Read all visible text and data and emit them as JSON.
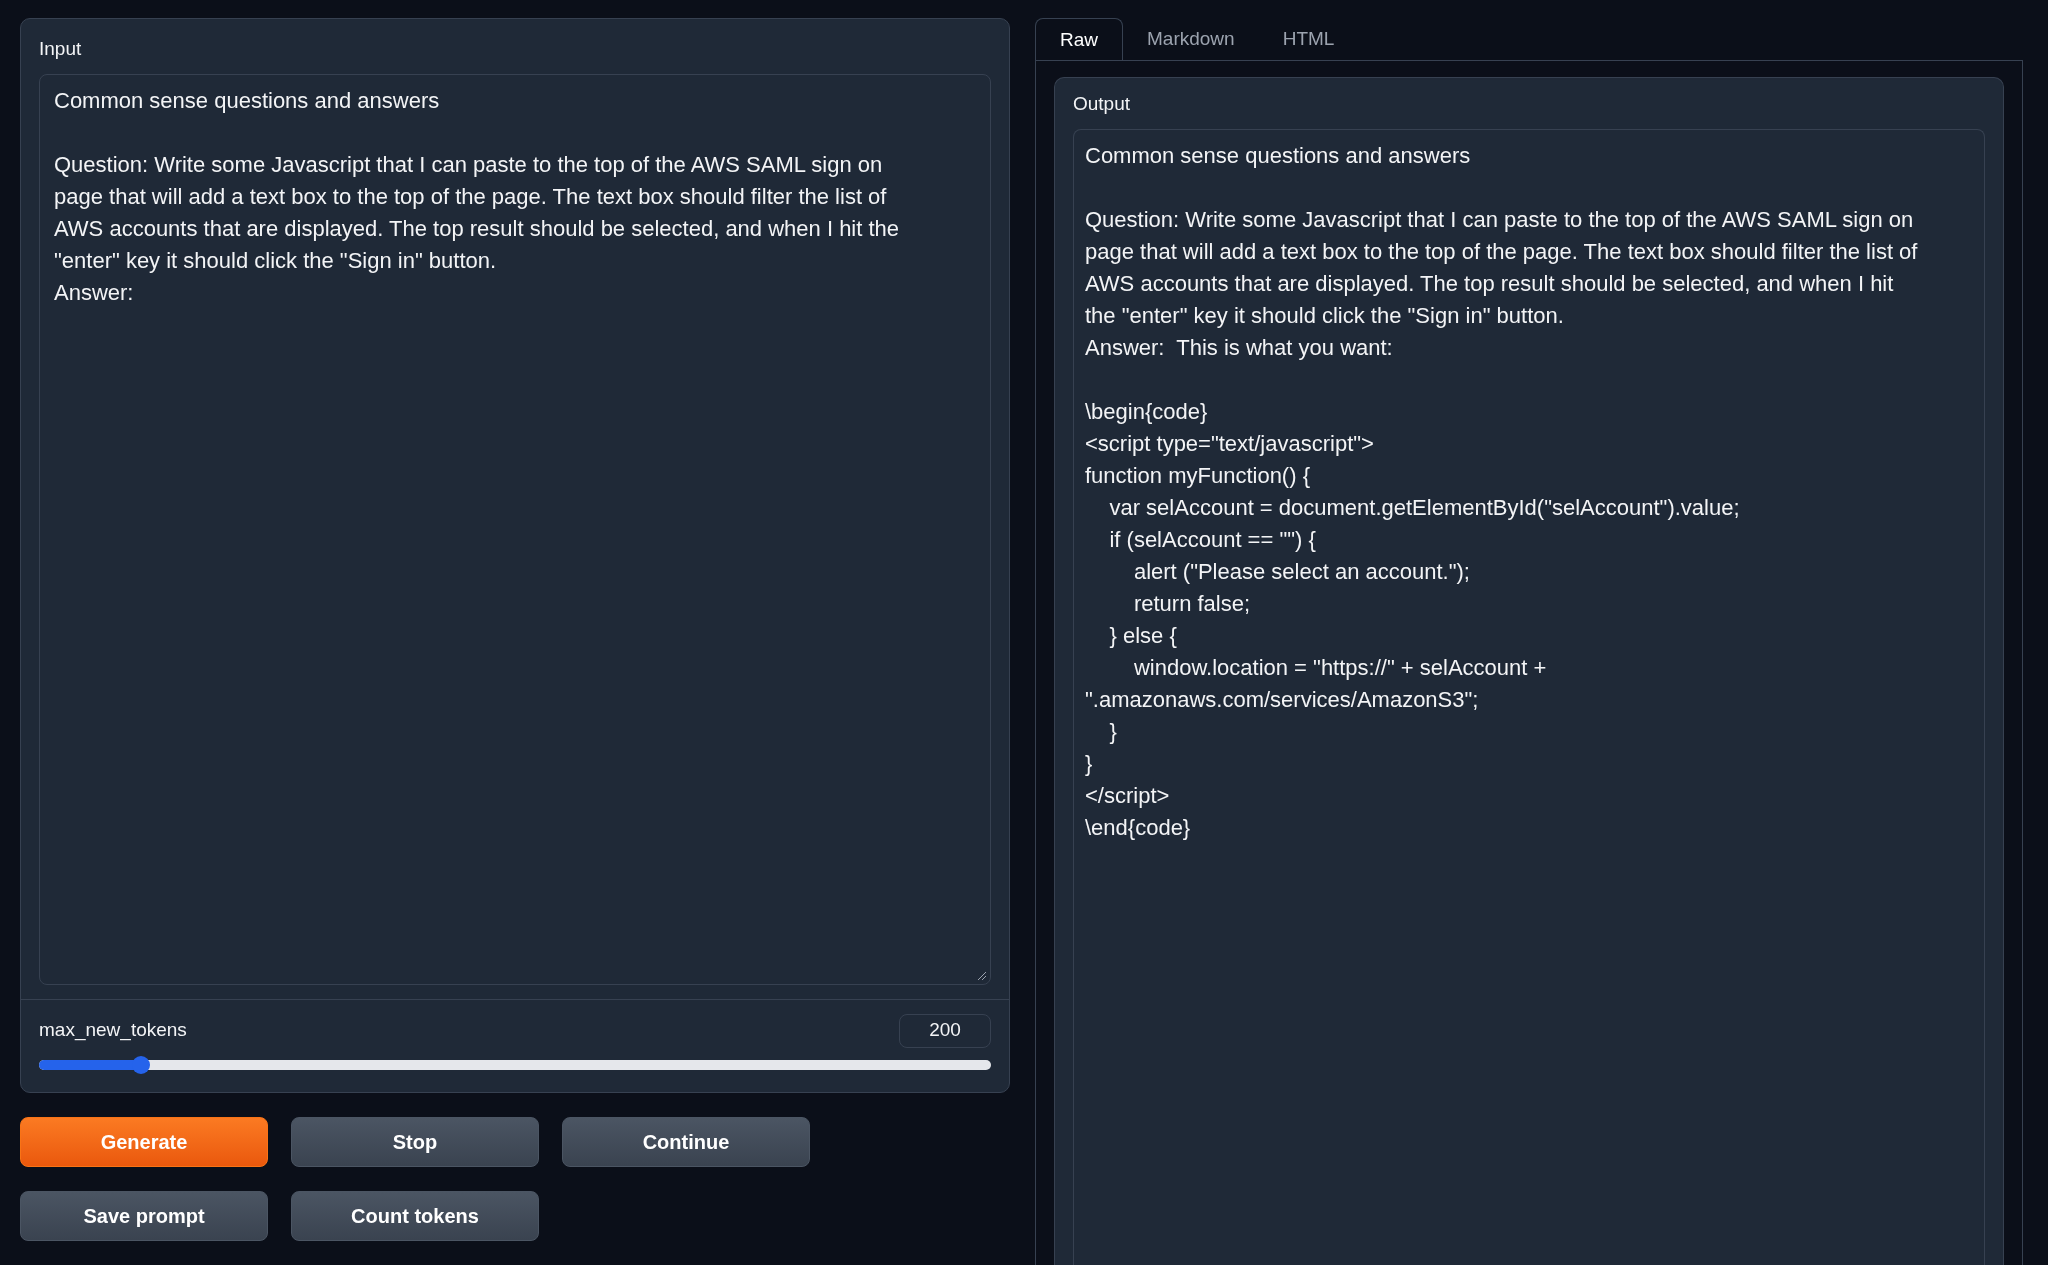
{
  "input": {
    "label": "Input",
    "paragraphs": [
      [
        "Common sense questions and answers"
      ],
      [
        "Question: Write some Javascript that I can paste to the top of the AWS SAML sign on",
        "page that will add a text box to the top of the page. The text box should filter the list of",
        "AWS accounts that are displayed. The top result should be selected, and when I hit the",
        "\"enter\" key it should click the \"Sign in\" button.",
        "Answer:"
      ]
    ]
  },
  "slider": {
    "label": "max_new_tokens",
    "value": "200",
    "level": 0.107
  },
  "buttons": [
    {
      "label": "Generate",
      "kind": "primary"
    },
    {
      "label": "Stop",
      "kind": "secondary"
    },
    {
      "label": "Continue",
      "kind": "secondary"
    },
    {
      "label": "Save prompt",
      "kind": "secondary"
    },
    {
      "label": "Count tokens",
      "kind": "secondary"
    }
  ],
  "tabs": [
    {
      "label": "Raw",
      "selected": true
    },
    {
      "label": "Markdown",
      "selected": false
    },
    {
      "label": "HTML",
      "selected": false
    }
  ],
  "output": {
    "label": "Output",
    "paragraphs": [
      [
        "Common sense questions and answers"
      ],
      [
        "Question: Write some Javascript that I can paste to the top of the AWS SAML sign on",
        "page that will add a text box to the top of the page. The text box should filter the list of",
        "AWS accounts that are displayed. The top result should be selected, and when I hit",
        "the \"enter\" key it should click the \"Sign in\" button.",
        "Answer:  This is what you want:"
      ],
      [
        "\\begin{code}",
        "<script type=\"text/javascript\">",
        "function myFunction() {",
        "    var selAccount = document.getElementById(\"selAccount\").value;",
        "    if (selAccount == \"\") {",
        "        alert (\"Please select an account.\");",
        "        return false;",
        "    } else {",
        "        window.location = \"https://\" + selAccount +",
        "\".amazonaws.com/services/AmazonS3\";",
        "    }",
        "}",
        "</script>",
        "\\end{code}"
      ]
    ]
  }
}
